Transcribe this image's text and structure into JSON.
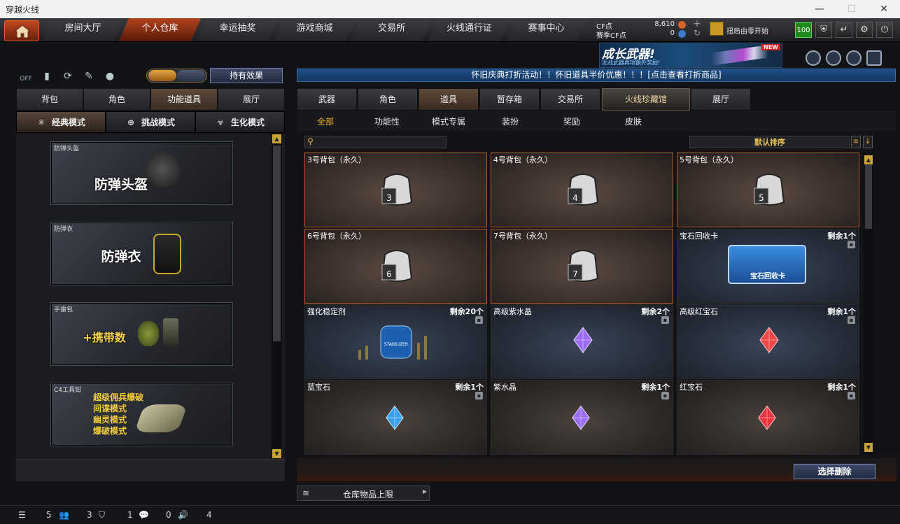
{
  "window": {
    "title": "穿越火线"
  },
  "nav": {
    "tabs": [
      "房间大厅",
      "个人仓库",
      "幸运抽奖",
      "游戏商城",
      "交易所",
      "火线通行证",
      "赛事中心"
    ],
    "active_index": 1
  },
  "currency": {
    "cf_label": "CF点",
    "cf_value": "8,610",
    "season_label": "赛季CF点",
    "season_value": "0"
  },
  "rank": {
    "title": "扭局由零开始"
  },
  "level": "100",
  "banner": {
    "title": "成长武器!",
    "subtitle": "近战武器再项额外奖励!",
    "badge": "NEW"
  },
  "left": {
    "toolbar": {
      "off_label": "OFF",
      "effect_button": "持有效果"
    },
    "tabs": [
      "背包",
      "角色",
      "功能道具",
      "展厅"
    ],
    "active_tab": 2,
    "modes": [
      "经典模式",
      "挑战模式",
      "生化模式"
    ],
    "active_mode": 0,
    "equipment": [
      {
        "name": "防弹头盔",
        "display": "防弹头盔"
      },
      {
        "name": "防弹衣",
        "display": "防弹衣"
      },
      {
        "name": "手雷包",
        "display": "+携带数"
      },
      {
        "name": "C4工具钳",
        "lines": [
          "超级佣兵爆破",
          "间谍模式",
          "幽灵模式",
          "爆破模式"
        ]
      }
    ]
  },
  "notice": "怀旧庆典打折活动！！怀旧道具半价优惠！！！[点击查看打折商品]",
  "right": {
    "tabs": [
      "武器",
      "角色",
      "道具",
      "暂存箱",
      "交易所",
      "火线珍藏馆",
      "展厅"
    ],
    "active_tab": 2,
    "special_tab": 5,
    "subtabs": [
      "全部",
      "功能性",
      "模式专属",
      "装扮",
      "奖励",
      "皮肤"
    ],
    "active_subtab": 0,
    "search_placeholder": "",
    "sort_label": "默认排序",
    "items": [
      {
        "name": "3号背包（永久）",
        "remain": "",
        "kind": "bag",
        "bag_no": "3"
      },
      {
        "name": "4号背包（永久）",
        "remain": "",
        "kind": "bag",
        "bag_no": "4"
      },
      {
        "name": "5号背包（永久）",
        "remain": "",
        "kind": "bag",
        "bag_no": "5"
      },
      {
        "name": "6号背包（永久）",
        "remain": "",
        "kind": "bag",
        "bag_no": "6"
      },
      {
        "name": "7号背包（永久）",
        "remain": "",
        "kind": "bag",
        "bag_no": "7"
      },
      {
        "name": "宝石回收卡",
        "remain": "剩余1个",
        "kind": "card",
        "card_text": "宝石回收卡"
      },
      {
        "name": "强化稳定剂",
        "remain": "剩余20个",
        "kind": "jar",
        "jar_text": "STABILIZER"
      },
      {
        "name": "高级紫水晶",
        "remain": "剩余2个",
        "kind": "gem",
        "color": "#9b6cf0"
      },
      {
        "name": "高级红宝石",
        "remain": "剩余1个",
        "kind": "gem",
        "color": "#f04646"
      },
      {
        "name": "蓝宝石",
        "remain": "剩余1个",
        "kind": "gem",
        "color": "#3aa0ee"
      },
      {
        "name": "紫水晶",
        "remain": "剩余1个",
        "kind": "gem",
        "color": "#9b6cf0"
      },
      {
        "name": "红宝石",
        "remain": "剩余1个",
        "kind": "gem",
        "color": "#e8343c"
      }
    ],
    "delete_button": "选择删除",
    "capacity_label": "仓库物品上限"
  },
  "status": {
    "values": [
      "5",
      "3",
      "1",
      "0",
      "4"
    ]
  }
}
